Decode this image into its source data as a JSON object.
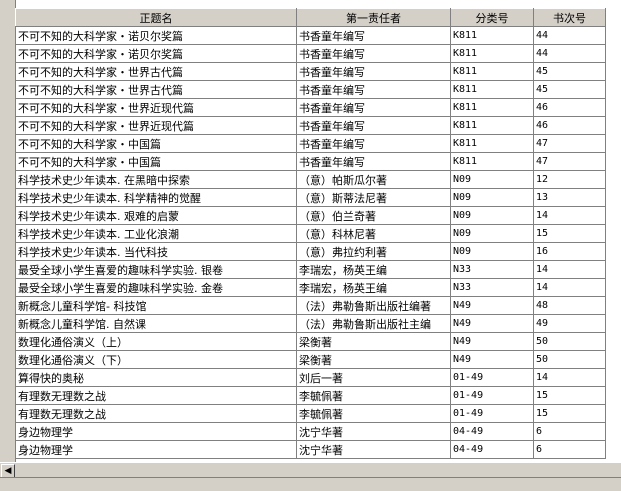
{
  "columns": [
    "正题名",
    "第一责任者",
    "分类号",
    "书次号"
  ],
  "rows": [
    [
      "不可不知的大科学家・诺贝尔奖篇",
      "书香童年编写",
      "K811",
      "44"
    ],
    [
      "不可不知的大科学家・诺贝尔奖篇",
      "书香童年编写",
      "K811",
      "44"
    ],
    [
      "不可不知的大科学家・世界古代篇",
      "书香童年编写",
      "K811",
      "45"
    ],
    [
      "不可不知的大科学家・世界古代篇",
      "书香童年编写",
      "K811",
      "45"
    ],
    [
      "不可不知的大科学家・世界近现代篇",
      "书香童年编写",
      "K811",
      "46"
    ],
    [
      "不可不知的大科学家・世界近现代篇",
      "书香童年编写",
      "K811",
      "46"
    ],
    [
      "不可不知的大科学家・中国篇",
      "书香童年编写",
      "K811",
      "47"
    ],
    [
      "不可不知的大科学家・中国篇",
      "书香童年编写",
      "K811",
      "47"
    ],
    [
      "科学技术史少年读本. 在黑暗中探索",
      "（意）帕斯瓜尔著",
      "N09",
      "12"
    ],
    [
      "科学技术史少年读本. 科学精神的觉醒",
      "（意）斯蒂法尼著",
      "N09",
      "13"
    ],
    [
      "科学技术史少年读本. 艰难的启蒙",
      "（意）伯兰奇著",
      "N09",
      "14"
    ],
    [
      "科学技术史少年读本. 工业化浪潮",
      "（意）科林尼著",
      "N09",
      "15"
    ],
    [
      "科学技术史少年读本. 当代科技",
      "（意）弗拉约利著",
      "N09",
      "16"
    ],
    [
      "最受全球小学生喜爱的趣味科学实验. 银卷",
      "李瑞宏，杨英王编",
      "N33",
      "14"
    ],
    [
      "最受全球小学生喜爱的趣味科学实验. 金卷",
      "李瑞宏，杨英王编",
      "N33",
      "14"
    ],
    [
      "新概念儿童科学馆- 科技馆",
      "（法）弗勒鲁斯出版社编著",
      "N49",
      "48"
    ],
    [
      "新概念儿童科学馆. 自然课",
      "（法）弗勒鲁斯出版社主编",
      "N49",
      "49"
    ],
    [
      "数理化通俗演义（上）",
      "梁衡著",
      "N49",
      "50"
    ],
    [
      "数理化通俗演义（下）",
      "梁衡著",
      "N49",
      "50"
    ],
    [
      "算得快的奥秘",
      "刘后一著",
      "01-49",
      "14"
    ],
    [
      "有理数无理数之战",
      "李毓佩著",
      "01-49",
      "15"
    ],
    [
      "有理数无理数之战",
      "李毓佩著",
      "01-49",
      "15"
    ],
    [
      "身边物理学",
      "沈宁华著",
      "04-49",
      "6"
    ],
    [
      "身边物理学",
      "沈宁华著",
      "04-49",
      "6"
    ]
  ],
  "icons": {
    "scroll_left": "left-arrow-icon"
  }
}
